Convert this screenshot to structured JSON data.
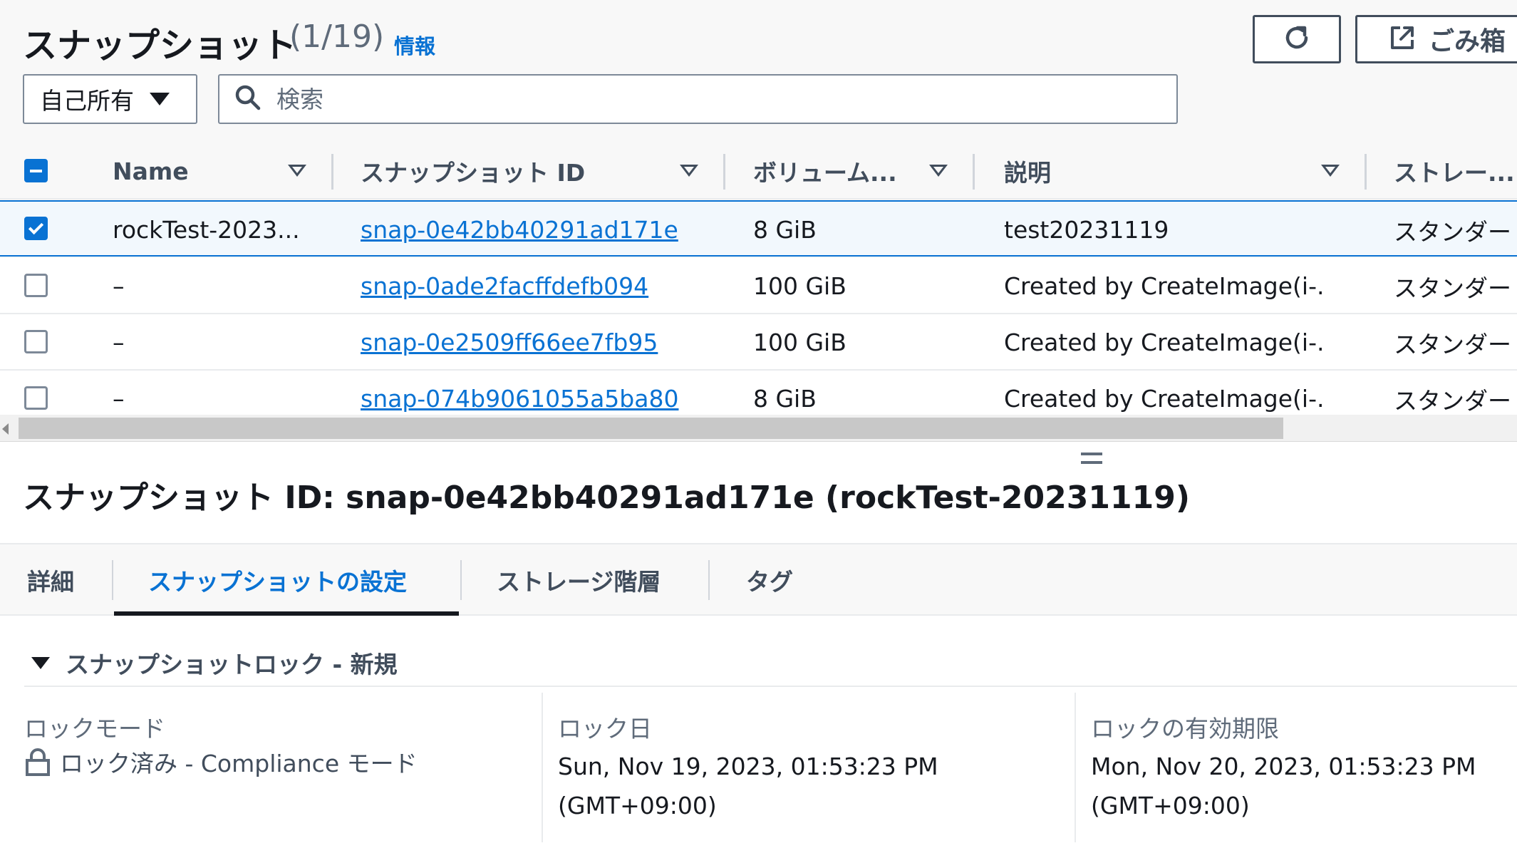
{
  "header": {
    "title": "スナップショット",
    "count": "(1/19)",
    "info_link": "情報",
    "refresh_icon": "refresh-icon",
    "trash_label": "ごみ箱",
    "trash_icon": "external-link-icon"
  },
  "filters": {
    "owner_select": "自己所有",
    "search_placeholder": "検索"
  },
  "table": {
    "columns": [
      "Name",
      "スナップショット ID",
      "ボリューム...",
      "説明",
      "ストレー..."
    ],
    "rows": [
      {
        "selected": true,
        "name": "rockTest-2023...",
        "snapshot_id": "snap-0e42bb40291ad171e",
        "volume": "8 GiB",
        "description": "test20231119",
        "storage": "スタンダード"
      },
      {
        "selected": false,
        "name": "–",
        "snapshot_id": "snap-0ade2facffdefb094",
        "volume": "100 GiB",
        "description": "Created by CreateImage(i-...",
        "storage": "スタンダード"
      },
      {
        "selected": false,
        "name": "–",
        "snapshot_id": "snap-0e2509ff66ee7fb95",
        "volume": "100 GiB",
        "description": "Created by CreateImage(i-...",
        "storage": "スタンダード"
      },
      {
        "selected": false,
        "name": "–",
        "snapshot_id": "snap-074b9061055a5ba80",
        "volume": "8 GiB",
        "description": "Created by CreateImage(i-...",
        "storage": "スタンダード"
      }
    ]
  },
  "details": {
    "title": "スナップショット ID: snap-0e42bb40291ad171e (rockTest-20231119)",
    "tabs": [
      "詳細",
      "スナップショットの設定",
      "ストレージ階層",
      "タグ"
    ],
    "active_tab": "スナップショットの設定",
    "section_title": "スナップショットロック - 新規",
    "fields": {
      "lock_mode_label": "ロックモード",
      "lock_mode_value": "ロック済み - Compliance モード",
      "lock_date_label": "ロック日",
      "lock_date_value": "Sun, Nov 19, 2023, 01:53:23 PM",
      "lock_date_tz": "(GMT+09:00)",
      "lock_expiry_label": "ロックの有効期限",
      "lock_expiry_value": "Mon, Nov 20, 2023, 01:53:23 PM",
      "lock_expiry_tz": "(GMT+09:00)"
    }
  },
  "colors": {
    "link": "#0972d3",
    "text": "#16191f",
    "muted": "#5f6b7a",
    "selected_row_bg": "#f2f8fd"
  }
}
